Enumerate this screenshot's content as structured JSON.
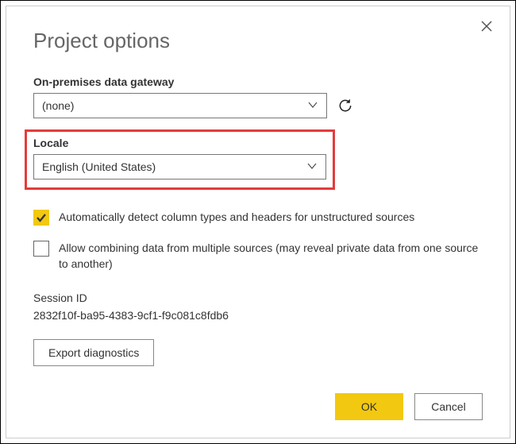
{
  "dialog": {
    "title": "Project options",
    "close_icon": "close"
  },
  "gateway": {
    "label": "On-premises data gateway",
    "value": "(none)"
  },
  "locale": {
    "label": "Locale",
    "value": "English (United States)"
  },
  "options": {
    "auto_detect": {
      "checked": true,
      "label": "Automatically detect column types and headers for unstructured sources"
    },
    "allow_combining": {
      "checked": false,
      "label": "Allow combining data from multiple sources (may reveal private data from one source to another)"
    }
  },
  "session": {
    "label": "Session ID",
    "value": "2832f10f-ba95-4383-9cf1-f9c081c8fdb6"
  },
  "buttons": {
    "export": "Export diagnostics",
    "ok": "OK",
    "cancel": "Cancel"
  }
}
